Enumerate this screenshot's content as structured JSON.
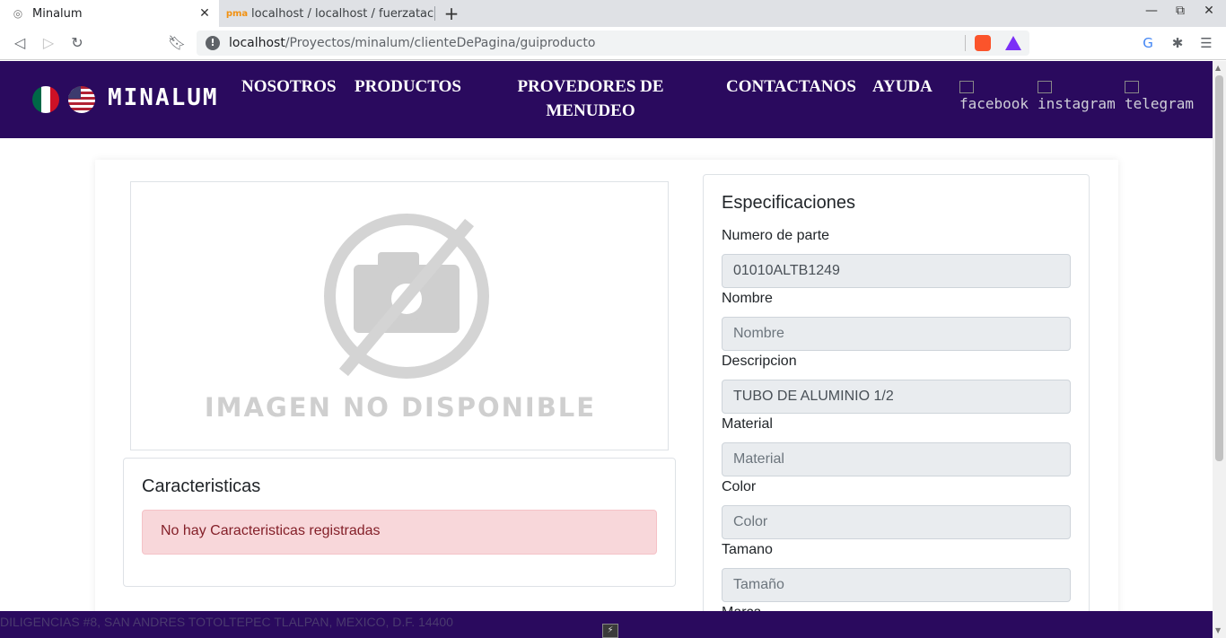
{
  "browser": {
    "tabs": [
      {
        "title": "Minalum",
        "active": true
      },
      {
        "title": "localhost / localhost / fuerzatac",
        "active": false
      }
    ],
    "url_host": "localhost",
    "url_path": "/Proyectos/minalum/clienteDePagina/guiproducto"
  },
  "nav": {
    "brand": "MINALUM",
    "links": [
      "NOSOTROS",
      "PRODUCTOS",
      "PROVEDORES DE",
      "MENUDEO",
      "CONTACTANOS",
      "AYUDA"
    ],
    "social": [
      "facebook",
      "instagram",
      "telegram"
    ]
  },
  "product": {
    "image_text": "IMAGEN NO DISPONIBLE",
    "features_title": "Caracteristicas",
    "features_alert": "No hay Caracteristicas registradas"
  },
  "specs": {
    "title": "Especificaciones",
    "fields": [
      {
        "label": "Numero de parte",
        "value": "01010ALTB1249",
        "placeholder": ""
      },
      {
        "label": "Nombre",
        "value": "",
        "placeholder": "Nombre"
      },
      {
        "label": "Descripcion",
        "value": "TUBO DE ALUMINIO 1/2",
        "placeholder": ""
      },
      {
        "label": "Material",
        "value": "",
        "placeholder": "Material"
      },
      {
        "label": "Color",
        "value": "",
        "placeholder": "Color"
      },
      {
        "label": "Tamano",
        "value": "",
        "placeholder": "Tamaño"
      },
      {
        "label": "Marca",
        "value": "",
        "placeholder": ""
      }
    ]
  },
  "footer": {
    "address": "DILIGENCIAS #8, SAN ANDRES TOTOLTEPEC TLALPAN, MEXICO, D.F. 14400"
  },
  "colors": {
    "nav_bg": "#2a0a5e",
    "alert_bg": "#f8d7da",
    "input_bg": "#e9ecef"
  }
}
